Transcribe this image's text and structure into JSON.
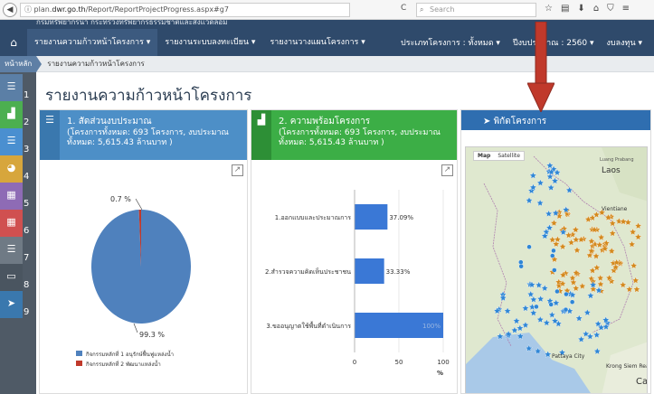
{
  "browser": {
    "url_prefix": "plan.",
    "url_domain": "dwr.go.th",
    "url_path": "/Report/ReportProjectProgress.aspx#g7",
    "search_placeholder": "Search",
    "reload_glyph": "C"
  },
  "header": {
    "cut_title": "กรมทรัพยากรน้ำ กระทรวงทรัพยากรธรรมชาติและสิ่งแวดล้อม"
  },
  "nav": {
    "menu": [
      "รายงานความก้าวหน้าโครงการ ▾",
      "รายงานระบบลงทะเบียน ▾",
      "รายงานวางแผนโครงการ ▾"
    ],
    "filters": [
      "ประเภทโครงการ : ทั้งหมด ▾",
      "ปีงบประมาณ : 2560 ▾",
      "งบลงทุน ▾"
    ]
  },
  "breadcrumb": {
    "home": "หน้าหลัก",
    "current": "รายงานความก้าวหน้าโครงการ"
  },
  "sidebar": {
    "items": [
      {
        "num": "1",
        "icon": "list-icon",
        "color": "#5b7fa6"
      },
      {
        "num": "2",
        "icon": "bar-chart-icon",
        "color": "#4caf50"
      },
      {
        "num": "3",
        "icon": "list-icon",
        "color": "#4a8fd0"
      },
      {
        "num": "4",
        "icon": "palette-icon",
        "color": "#d7a63c"
      },
      {
        "num": "5",
        "icon": "calendar-icon",
        "color": "#8e6bb5"
      },
      {
        "num": "6",
        "icon": "calendar-icon",
        "color": "#d05050"
      },
      {
        "num": "7",
        "icon": "list-icon",
        "color": "#6f7a85"
      },
      {
        "num": "8",
        "icon": "monitor-icon",
        "color": "#4a5560"
      },
      {
        "num": "9",
        "icon": "location-arrow-icon",
        "color": "#3a78ae"
      }
    ]
  },
  "page": {
    "title": "รายงานความก้าวหน้าโครงการ"
  },
  "panel1": {
    "title": "1. สัดส่วนงบประมาณ",
    "subtitle": "(โครงการทั้งหมด: 693 โครงการ, งบประมาณทั้งหมด: 5,615.43 ล้านบาท )"
  },
  "panel2": {
    "title": "2. ความพร้อมโครงการ",
    "subtitle": "(โครงการทั้งหมด: 693 โครงการ, งบประมาณทั้งหมด: 5,615.43 ล้านบาท )"
  },
  "panel3": {
    "title": "พิกัดโครงการ",
    "map_buttons": [
      "Map",
      "Satellite"
    ],
    "map_labels": [
      "Laos",
      "Vientiane",
      "Pattaya City",
      "Krong Siem Reap",
      "Ca",
      "Luang Prabang"
    ]
  },
  "chart_data": [
    {
      "type": "pie",
      "values": [
        99.3,
        0.7
      ],
      "slice_labels": [
        "99.3 %",
        "0.7 %"
      ],
      "legend": [
        {
          "name": "กิจกรรมหลักที่ 1 อนุรักษ์ฟื้นฟูแหล่งน้ำ",
          "color": "#4f81bd"
        },
        {
          "name": "กิจกรรมหลักที่ 2 พัฒนาแหล่งน้ำ",
          "color": "#c0392b"
        }
      ],
      "colors": [
        "#4f81bd",
        "#c0392b"
      ],
      "legend_position": "bottom"
    },
    {
      "type": "bar",
      "orientation": "horizontal",
      "categories": [
        "1.ออกแบบและประมาณการ",
        "2.สำรวจความคิดเห็นประชาชน",
        "3.ขออนุญาตใช้พื้นที่ดำเนินการ"
      ],
      "values": [
        37.09,
        33.33,
        100
      ],
      "data_labels": [
        "37.09%",
        "33.33%",
        "100%"
      ],
      "xlim": [
        0,
        100
      ],
      "xticks": [
        "0",
        "50",
        "100"
      ],
      "xunit": "%",
      "color": "#3a78d6",
      "grid": true
    }
  ]
}
